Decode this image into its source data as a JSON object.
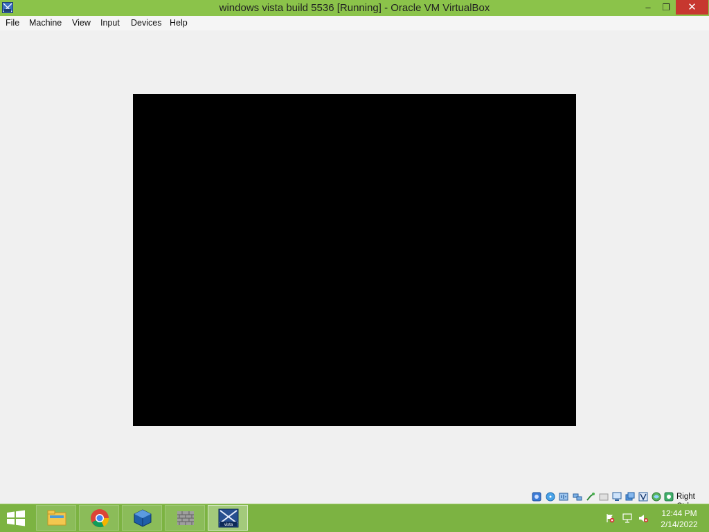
{
  "window": {
    "title": "windows vista build 5536 [Running] - Oracle VM VirtualBox",
    "minimize_glyph": "–",
    "maximize_glyph": "❐",
    "close_glyph": "✕"
  },
  "menu": {
    "items": [
      {
        "label": "File"
      },
      {
        "label": "Machine"
      },
      {
        "label": "View"
      },
      {
        "label": "Input"
      },
      {
        "label": "Devices"
      },
      {
        "label": "Help"
      }
    ]
  },
  "statusbar": {
    "icons": [
      "hard-disk-icon",
      "optical-drive-icon",
      "audio-icon",
      "network-icon",
      "usb-icon",
      "shared-folders-icon",
      "display-icon",
      "video-capture-icon",
      "cpu-icon",
      "virtualization-icon",
      "mouse-integration-icon"
    ],
    "host_key_label": "Right Ctrl"
  },
  "taskbar": {
    "apps": [
      {
        "name": "file-explorer"
      },
      {
        "name": "google-chrome"
      },
      {
        "name": "virtualbox"
      },
      {
        "name": "firewall"
      },
      {
        "name": "windows-vista-vm",
        "label": "vista"
      }
    ],
    "clock_time": "12:44 PM",
    "clock_date": "2/14/2022"
  },
  "colors": {
    "titlebar": "#8bc34a",
    "taskbar": "#7cb342",
    "close_button": "#c7372f",
    "vm_screen": "#000000"
  }
}
